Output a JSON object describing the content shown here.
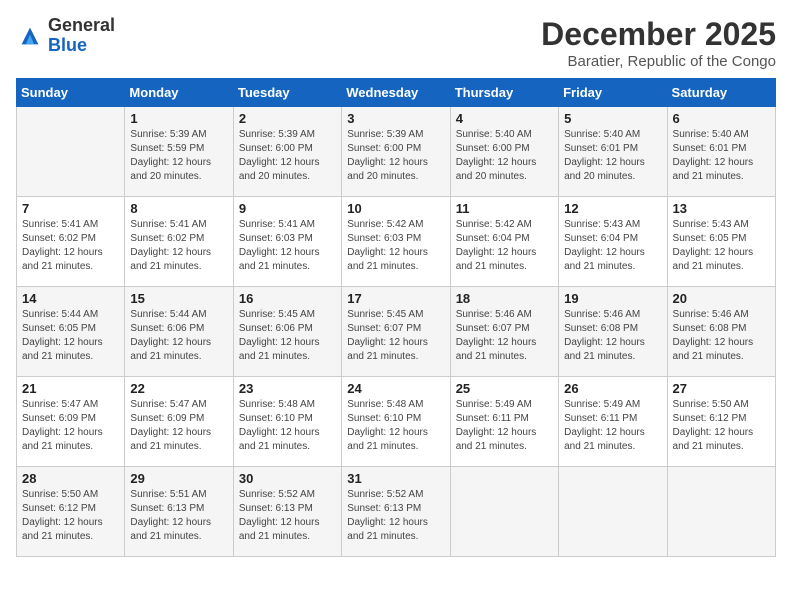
{
  "logo": {
    "general": "General",
    "blue": "Blue"
  },
  "title": {
    "month_year": "December 2025",
    "location": "Baratier, Republic of the Congo"
  },
  "headers": [
    "Sunday",
    "Monday",
    "Tuesday",
    "Wednesday",
    "Thursday",
    "Friday",
    "Saturday"
  ],
  "weeks": [
    [
      {
        "day": "",
        "sunrise": "",
        "sunset": "",
        "daylight": ""
      },
      {
        "day": "1",
        "sunrise": "Sunrise: 5:39 AM",
        "sunset": "Sunset: 5:59 PM",
        "daylight": "Daylight: 12 hours and 20 minutes."
      },
      {
        "day": "2",
        "sunrise": "Sunrise: 5:39 AM",
        "sunset": "Sunset: 6:00 PM",
        "daylight": "Daylight: 12 hours and 20 minutes."
      },
      {
        "day": "3",
        "sunrise": "Sunrise: 5:39 AM",
        "sunset": "Sunset: 6:00 PM",
        "daylight": "Daylight: 12 hours and 20 minutes."
      },
      {
        "day": "4",
        "sunrise": "Sunrise: 5:40 AM",
        "sunset": "Sunset: 6:00 PM",
        "daylight": "Daylight: 12 hours and 20 minutes."
      },
      {
        "day": "5",
        "sunrise": "Sunrise: 5:40 AM",
        "sunset": "Sunset: 6:01 PM",
        "daylight": "Daylight: 12 hours and 20 minutes."
      },
      {
        "day": "6",
        "sunrise": "Sunrise: 5:40 AM",
        "sunset": "Sunset: 6:01 PM",
        "daylight": "Daylight: 12 hours and 21 minutes."
      }
    ],
    [
      {
        "day": "7",
        "sunrise": "Sunrise: 5:41 AM",
        "sunset": "Sunset: 6:02 PM",
        "daylight": "Daylight: 12 hours and 21 minutes."
      },
      {
        "day": "8",
        "sunrise": "Sunrise: 5:41 AM",
        "sunset": "Sunset: 6:02 PM",
        "daylight": "Daylight: 12 hours and 21 minutes."
      },
      {
        "day": "9",
        "sunrise": "Sunrise: 5:41 AM",
        "sunset": "Sunset: 6:03 PM",
        "daylight": "Daylight: 12 hours and 21 minutes."
      },
      {
        "day": "10",
        "sunrise": "Sunrise: 5:42 AM",
        "sunset": "Sunset: 6:03 PM",
        "daylight": "Daylight: 12 hours and 21 minutes."
      },
      {
        "day": "11",
        "sunrise": "Sunrise: 5:42 AM",
        "sunset": "Sunset: 6:04 PM",
        "daylight": "Daylight: 12 hours and 21 minutes."
      },
      {
        "day": "12",
        "sunrise": "Sunrise: 5:43 AM",
        "sunset": "Sunset: 6:04 PM",
        "daylight": "Daylight: 12 hours and 21 minutes."
      },
      {
        "day": "13",
        "sunrise": "Sunrise: 5:43 AM",
        "sunset": "Sunset: 6:05 PM",
        "daylight": "Daylight: 12 hours and 21 minutes."
      }
    ],
    [
      {
        "day": "14",
        "sunrise": "Sunrise: 5:44 AM",
        "sunset": "Sunset: 6:05 PM",
        "daylight": "Daylight: 12 hours and 21 minutes."
      },
      {
        "day": "15",
        "sunrise": "Sunrise: 5:44 AM",
        "sunset": "Sunset: 6:06 PM",
        "daylight": "Daylight: 12 hours and 21 minutes."
      },
      {
        "day": "16",
        "sunrise": "Sunrise: 5:45 AM",
        "sunset": "Sunset: 6:06 PM",
        "daylight": "Daylight: 12 hours and 21 minutes."
      },
      {
        "day": "17",
        "sunrise": "Sunrise: 5:45 AM",
        "sunset": "Sunset: 6:07 PM",
        "daylight": "Daylight: 12 hours and 21 minutes."
      },
      {
        "day": "18",
        "sunrise": "Sunrise: 5:46 AM",
        "sunset": "Sunset: 6:07 PM",
        "daylight": "Daylight: 12 hours and 21 minutes."
      },
      {
        "day": "19",
        "sunrise": "Sunrise: 5:46 AM",
        "sunset": "Sunset: 6:08 PM",
        "daylight": "Daylight: 12 hours and 21 minutes."
      },
      {
        "day": "20",
        "sunrise": "Sunrise: 5:46 AM",
        "sunset": "Sunset: 6:08 PM",
        "daylight": "Daylight: 12 hours and 21 minutes."
      }
    ],
    [
      {
        "day": "21",
        "sunrise": "Sunrise: 5:47 AM",
        "sunset": "Sunset: 6:09 PM",
        "daylight": "Daylight: 12 hours and 21 minutes."
      },
      {
        "day": "22",
        "sunrise": "Sunrise: 5:47 AM",
        "sunset": "Sunset: 6:09 PM",
        "daylight": "Daylight: 12 hours and 21 minutes."
      },
      {
        "day": "23",
        "sunrise": "Sunrise: 5:48 AM",
        "sunset": "Sunset: 6:10 PM",
        "daylight": "Daylight: 12 hours and 21 minutes."
      },
      {
        "day": "24",
        "sunrise": "Sunrise: 5:48 AM",
        "sunset": "Sunset: 6:10 PM",
        "daylight": "Daylight: 12 hours and 21 minutes."
      },
      {
        "day": "25",
        "sunrise": "Sunrise: 5:49 AM",
        "sunset": "Sunset: 6:11 PM",
        "daylight": "Daylight: 12 hours and 21 minutes."
      },
      {
        "day": "26",
        "sunrise": "Sunrise: 5:49 AM",
        "sunset": "Sunset: 6:11 PM",
        "daylight": "Daylight: 12 hours and 21 minutes."
      },
      {
        "day": "27",
        "sunrise": "Sunrise: 5:50 AM",
        "sunset": "Sunset: 6:12 PM",
        "daylight": "Daylight: 12 hours and 21 minutes."
      }
    ],
    [
      {
        "day": "28",
        "sunrise": "Sunrise: 5:50 AM",
        "sunset": "Sunset: 6:12 PM",
        "daylight": "Daylight: 12 hours and 21 minutes."
      },
      {
        "day": "29",
        "sunrise": "Sunrise: 5:51 AM",
        "sunset": "Sunset: 6:13 PM",
        "daylight": "Daylight: 12 hours and 21 minutes."
      },
      {
        "day": "30",
        "sunrise": "Sunrise: 5:52 AM",
        "sunset": "Sunset: 6:13 PM",
        "daylight": "Daylight: 12 hours and 21 minutes."
      },
      {
        "day": "31",
        "sunrise": "Sunrise: 5:52 AM",
        "sunset": "Sunset: 6:13 PM",
        "daylight": "Daylight: 12 hours and 21 minutes."
      },
      {
        "day": "",
        "sunrise": "",
        "sunset": "",
        "daylight": ""
      },
      {
        "day": "",
        "sunrise": "",
        "sunset": "",
        "daylight": ""
      },
      {
        "day": "",
        "sunrise": "",
        "sunset": "",
        "daylight": ""
      }
    ]
  ]
}
